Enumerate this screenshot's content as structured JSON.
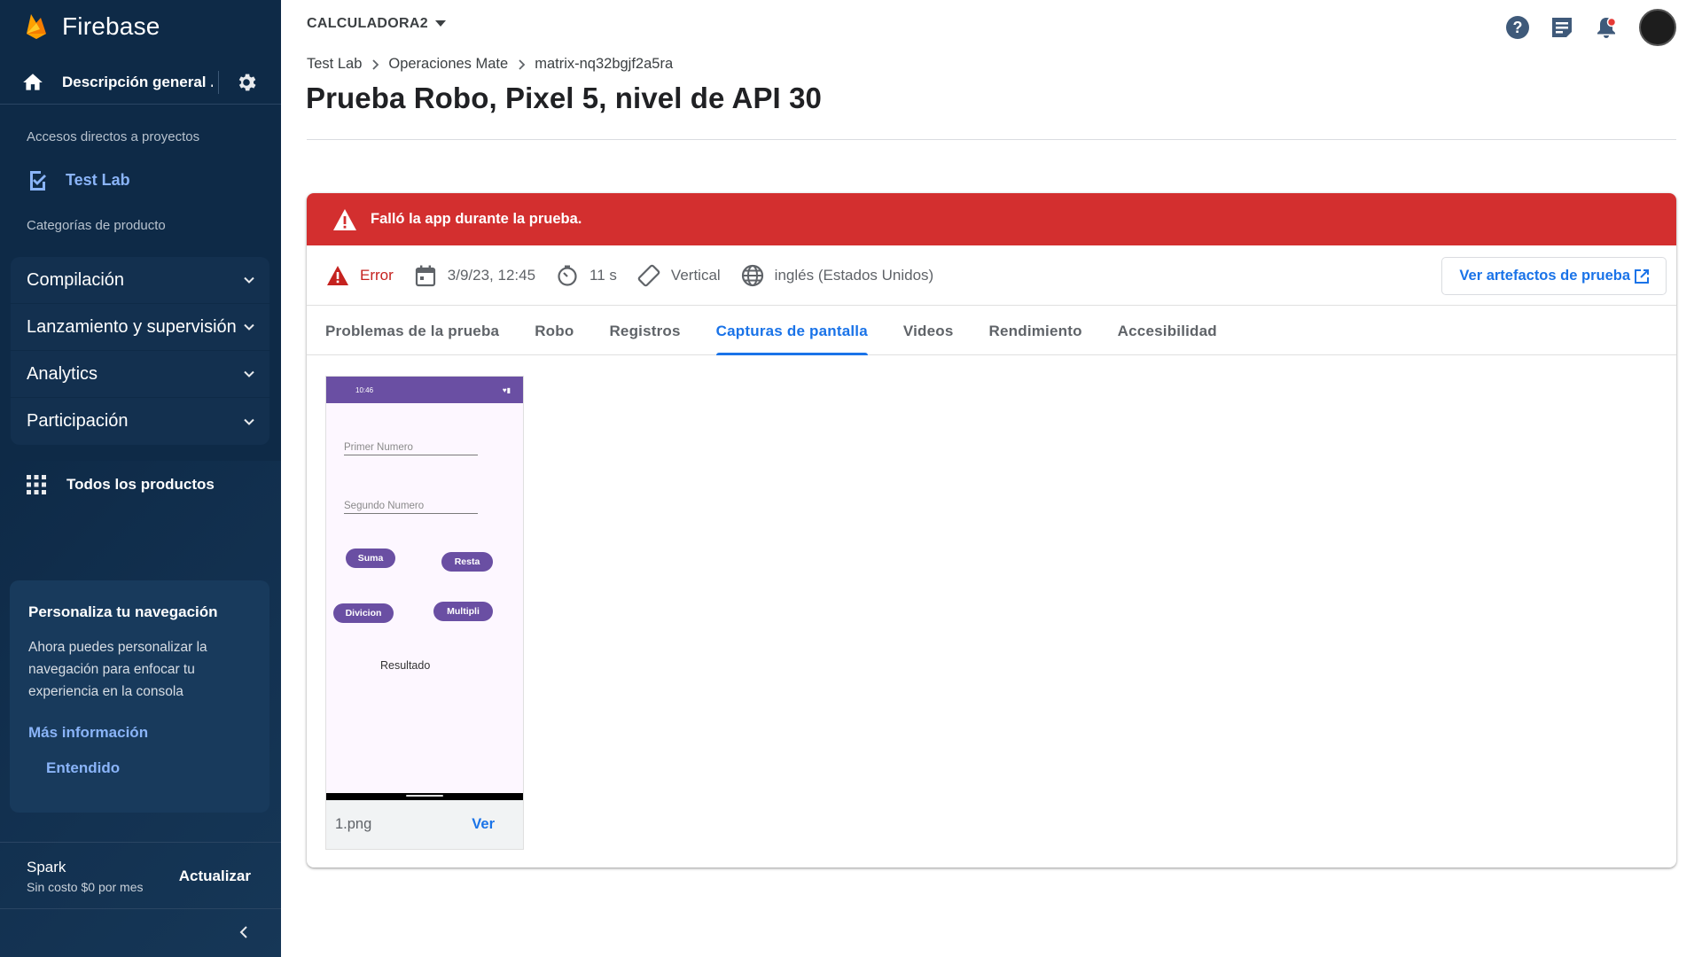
{
  "sidebar": {
    "brand": "Firebase",
    "overview_label": "Descripción general ...",
    "shortcuts_heading": "Accesos directos a proyectos",
    "test_lab_label": "Test Lab",
    "categories_heading": "Categorías de producto",
    "categories": [
      {
        "label": "Compilación"
      },
      {
        "label": "Lanzamiento y supervisión"
      },
      {
        "label": "Analytics"
      },
      {
        "label": "Participación"
      }
    ],
    "all_products_label": "Todos los productos",
    "promo": {
      "title": "Personaliza tu navegación",
      "body": "Ahora puedes personalizar la navegación para enfocar tu experiencia en la consola",
      "learn_more": "Más información",
      "dismiss": "Entendido"
    },
    "plan": {
      "name": "Spark",
      "price": "Sin costo $0 por mes",
      "upgrade": "Actualizar"
    }
  },
  "header": {
    "project_name": "CALCULADORA2",
    "breadcrumbs": [
      "Test Lab",
      "Operaciones Mate",
      "matrix-nq32bgjf2a5ra"
    ],
    "title": "Prueba Robo, Pixel 5, nivel de API 30",
    "icons": [
      "help-icon",
      "release-notes-icon",
      "notifications-icon"
    ]
  },
  "result": {
    "banner": "Falló la app durante la prueba.",
    "status": "Error",
    "date": "3/9/23, 12:45",
    "duration": "11 s",
    "orientation": "Vertical",
    "locale": "inglés (Estados Unidos)",
    "artifacts_button": "Ver artefactos de prueba",
    "tabs": [
      {
        "label": "Problemas de la prueba",
        "active": false
      },
      {
        "label": "Robo",
        "active": false
      },
      {
        "label": "Registros",
        "active": false
      },
      {
        "label": "Capturas de pantalla",
        "active": true
      },
      {
        "label": "Videos",
        "active": false
      },
      {
        "label": "Rendimiento",
        "active": false
      },
      {
        "label": "Accesibilidad",
        "active": false
      }
    ]
  },
  "screenshot": {
    "filename": "1.png",
    "view_label": "Ver",
    "phone": {
      "time": "10:46",
      "field1": "Primer Numero",
      "field2": "Segundo Numero",
      "btn_suma": "Suma",
      "btn_resta": "Resta",
      "btn_division": "Divicion",
      "btn_multi": "Multipli",
      "result": "Resultado"
    }
  },
  "colors": {
    "sidebar_bg": "#0e2a47",
    "accent": "#1a73e8",
    "error_banner": "#d32f2f",
    "phone_primary": "#6a4fa3"
  }
}
